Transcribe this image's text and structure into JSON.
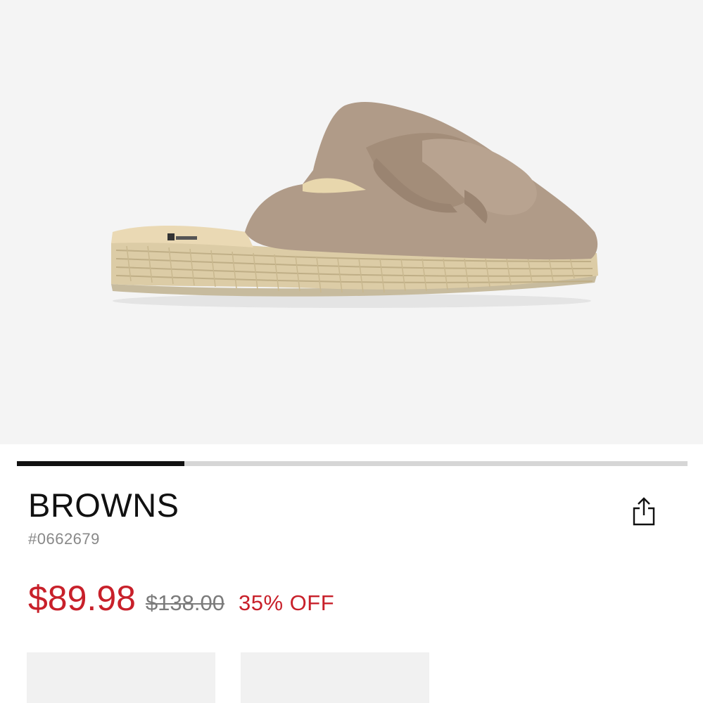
{
  "product": {
    "brand": "BROWNS",
    "sku": "#0662679",
    "image_alt": "Tan suede espadrille mule with bow"
  },
  "gallery": {
    "current_image": 1,
    "total_images": 4
  },
  "pricing": {
    "sale_price": "$89.98",
    "original_price": "$138.00",
    "discount": "35% OFF"
  },
  "icons": {
    "share": "share-icon"
  },
  "colors": {
    "sale": "#c8202a",
    "strike": "#7b7b7b",
    "hero_bg": "#f4f4f4",
    "progress_fill": "#111111",
    "progress_track": "#d6d6d6"
  }
}
